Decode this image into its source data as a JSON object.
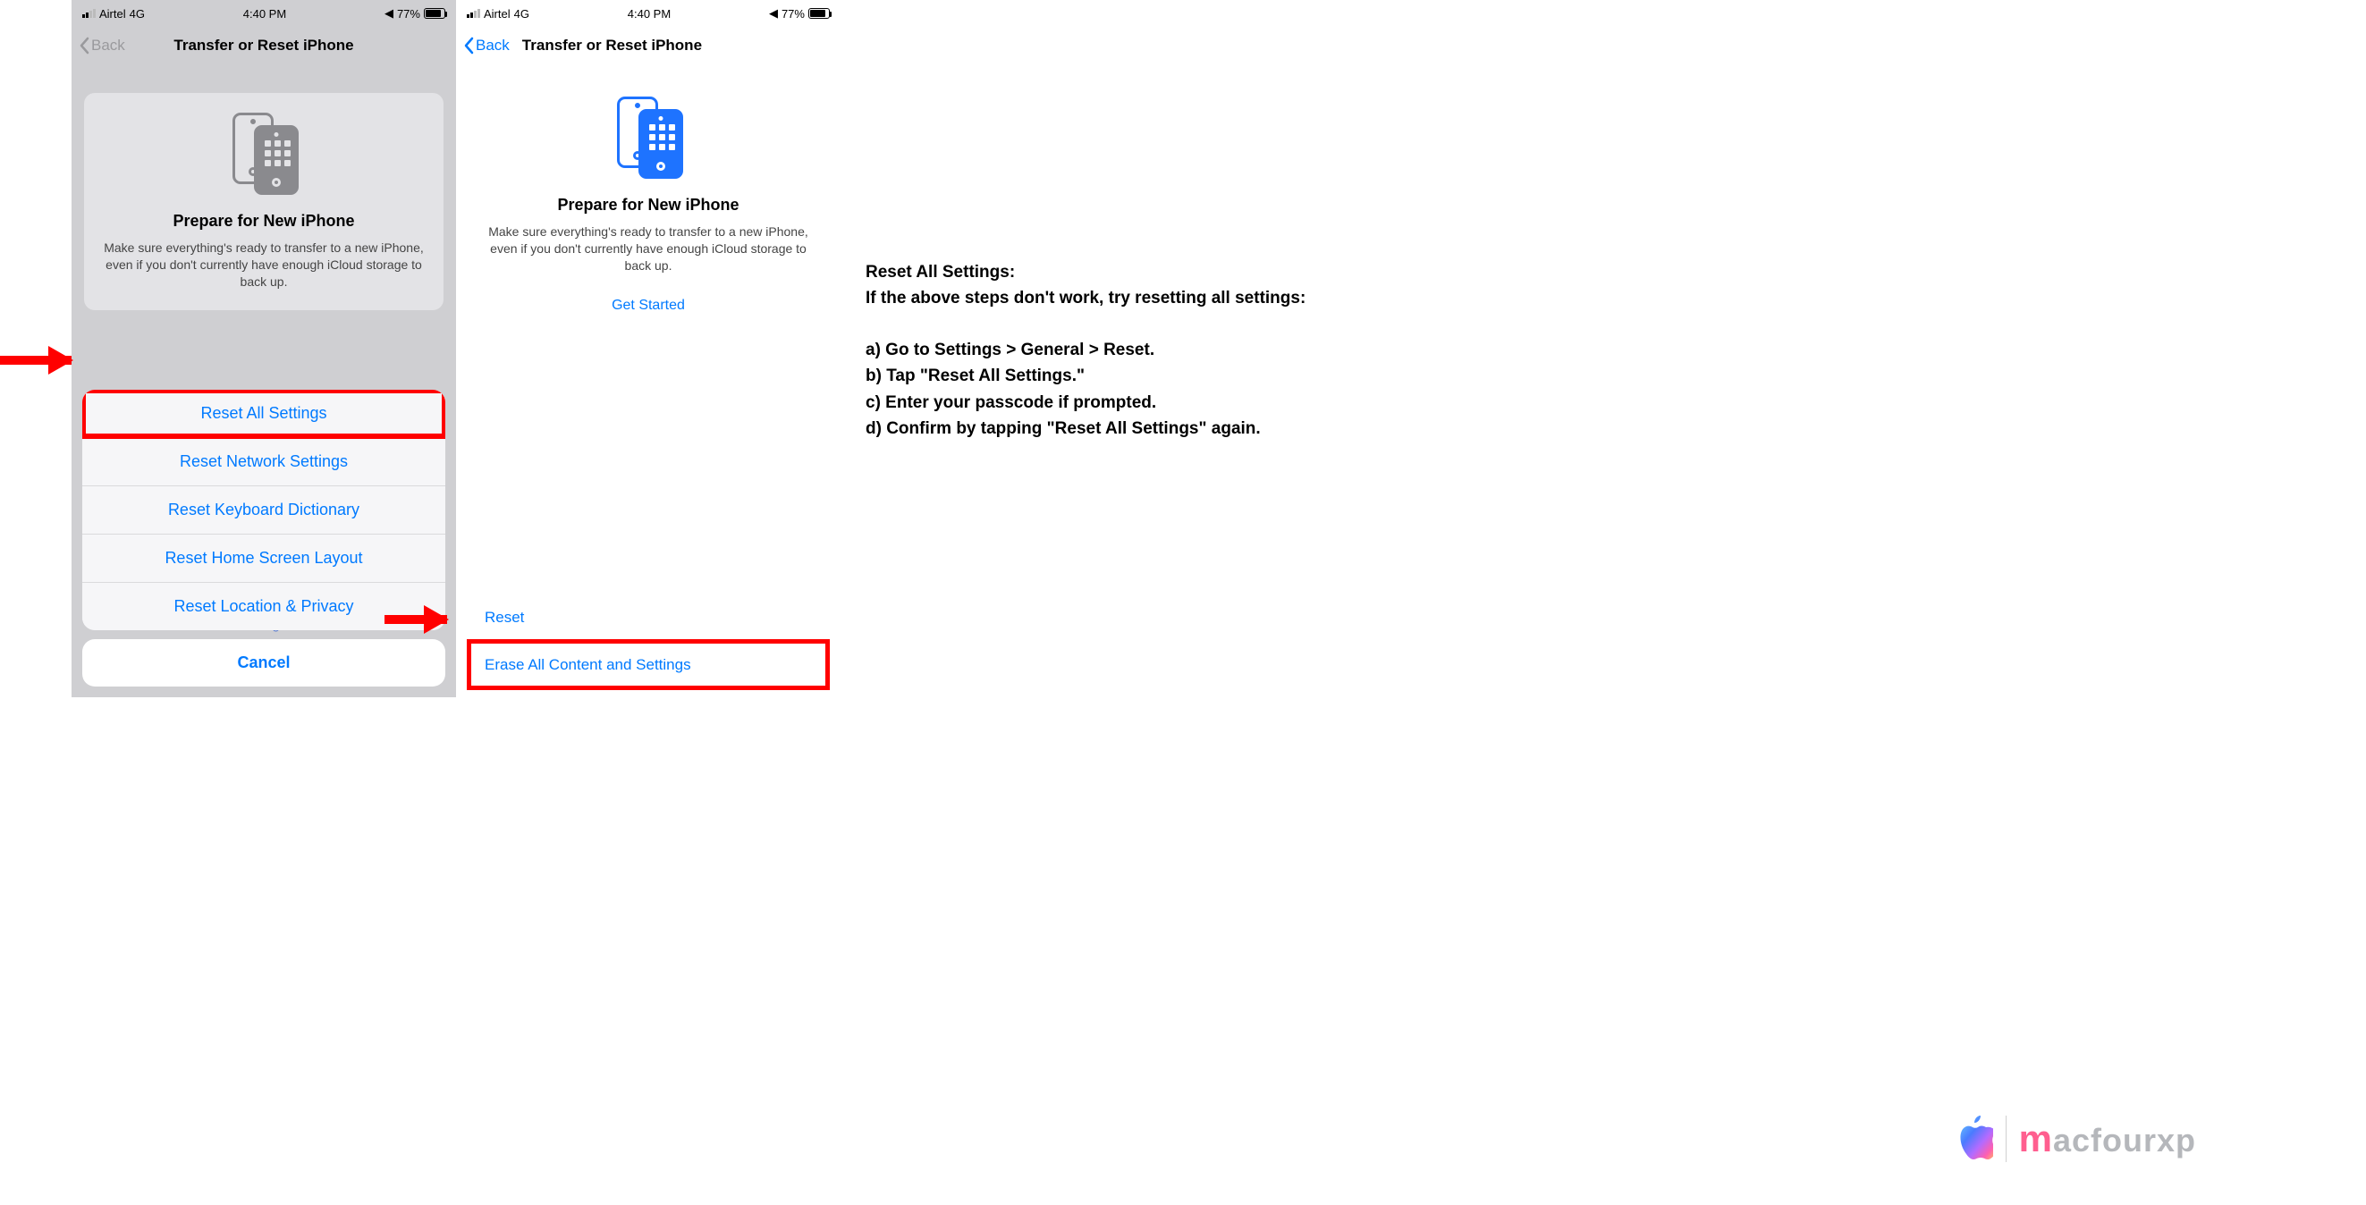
{
  "status": {
    "carrier": "Airtel",
    "net": "4G",
    "time": "4:40 PM",
    "battery_pct": "77%"
  },
  "nav": {
    "back": "Back",
    "title": "Transfer or Reset iPhone"
  },
  "prepare": {
    "title": "Prepare for New iPhone",
    "desc": "Make sure everything's ready to transfer to a new iPhone, even if you don't currently have enough iCloud storage to back up.",
    "cta": "Get Started"
  },
  "rows": {
    "reset": "Reset",
    "erase": "Erase All Content and Settings"
  },
  "sheet": {
    "items": [
      "Reset All Settings",
      "Reset Network Settings",
      "Reset Keyboard Dictionary",
      "Reset Home Screen Layout",
      "Reset Location & Privacy"
    ],
    "cancel": "Cancel",
    "hidden_erase": "Erase All Content and Settings"
  },
  "instructions": {
    "heading": "Reset All Settings:",
    "sub": "If the above steps don't work, try resetting all settings:",
    "a": "a) Go to Settings > General > Reset.",
    "b": "b) Tap \"Reset All Settings.\"",
    "c": "c) Enter your passcode if prompted.",
    "d": "d) Confirm by tapping \"Reset All Settings\" again."
  },
  "brand": {
    "m": "m",
    "rest": "acfourxp"
  }
}
